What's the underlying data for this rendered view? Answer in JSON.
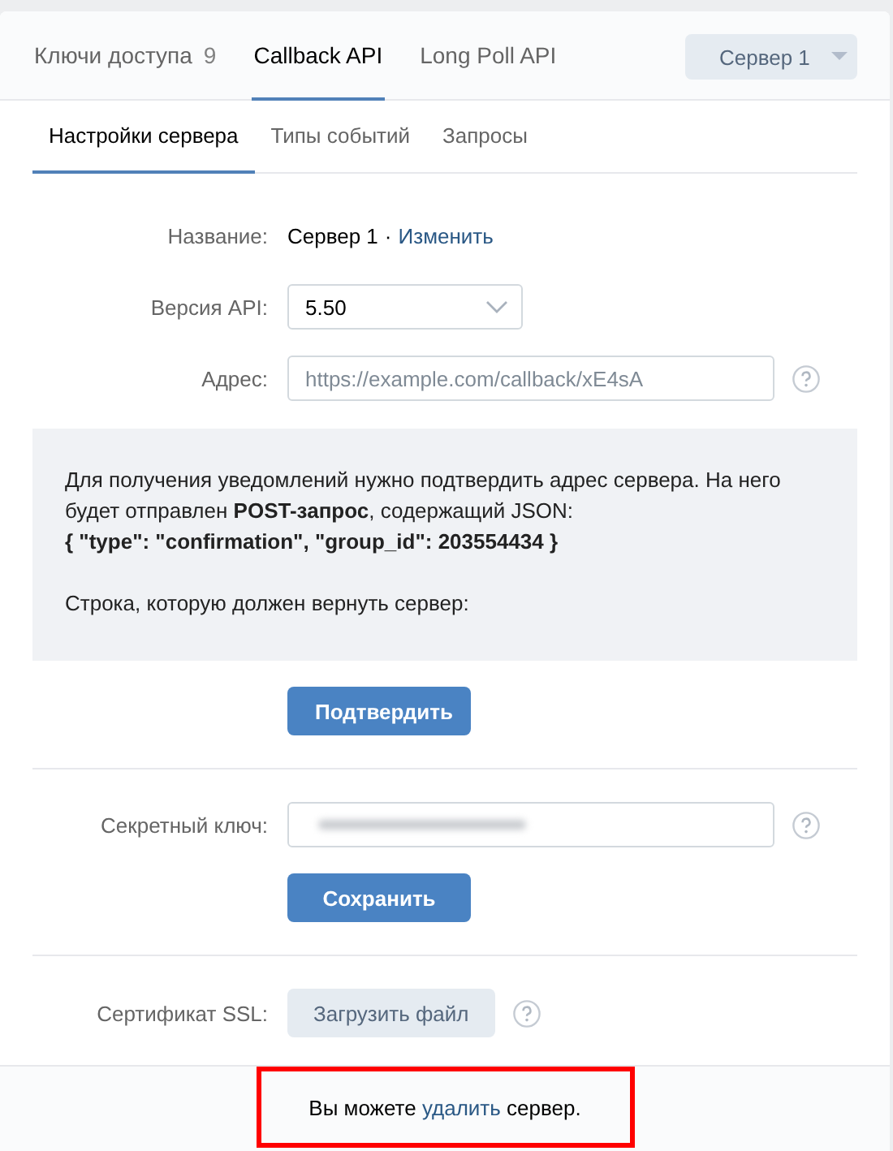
{
  "tabs": [
    {
      "label": "Ключи доступа",
      "count": "9",
      "selected": false
    },
    {
      "label": "Callback API",
      "selected": true
    },
    {
      "label": "Long Poll API",
      "selected": false
    }
  ],
  "server_dropdown": {
    "value": "Сервер 1"
  },
  "subtabs": [
    {
      "label": "Настройки сервера",
      "selected": true
    },
    {
      "label": "Типы событий",
      "selected": false
    },
    {
      "label": "Запросы",
      "selected": false
    }
  ],
  "name_row": {
    "label": "Название:",
    "value": "Сервер 1",
    "separator": "·",
    "link": "Изменить"
  },
  "version_row": {
    "label": "Версия API:",
    "value": "5.50"
  },
  "address_row": {
    "label": "Адрес:",
    "placeholder": "https://example.com/callback/xE4sA"
  },
  "info": {
    "text": "Для получения уведомлений нужно подтвердить адрес сервера. На него будет отправлен **POST-запрос**, содержащий JSON:",
    "json": "{ \"type\": \"confirmation\", \"group_id\": 203554434 }",
    "prompt": "Строка, которую должен вернуть сервер:"
  },
  "confirm_button": "Подтвердить",
  "secret_row": {
    "label": "Секретный ключ:"
  },
  "save_button": "Сохранить",
  "ssl_row": {
    "label": "Сертификат SSL:",
    "button": "Загрузить файл"
  },
  "footer": {
    "before": "Вы можете ",
    "link": "удалить",
    "after": " сервер.",
    "highlighted": true
  }
}
